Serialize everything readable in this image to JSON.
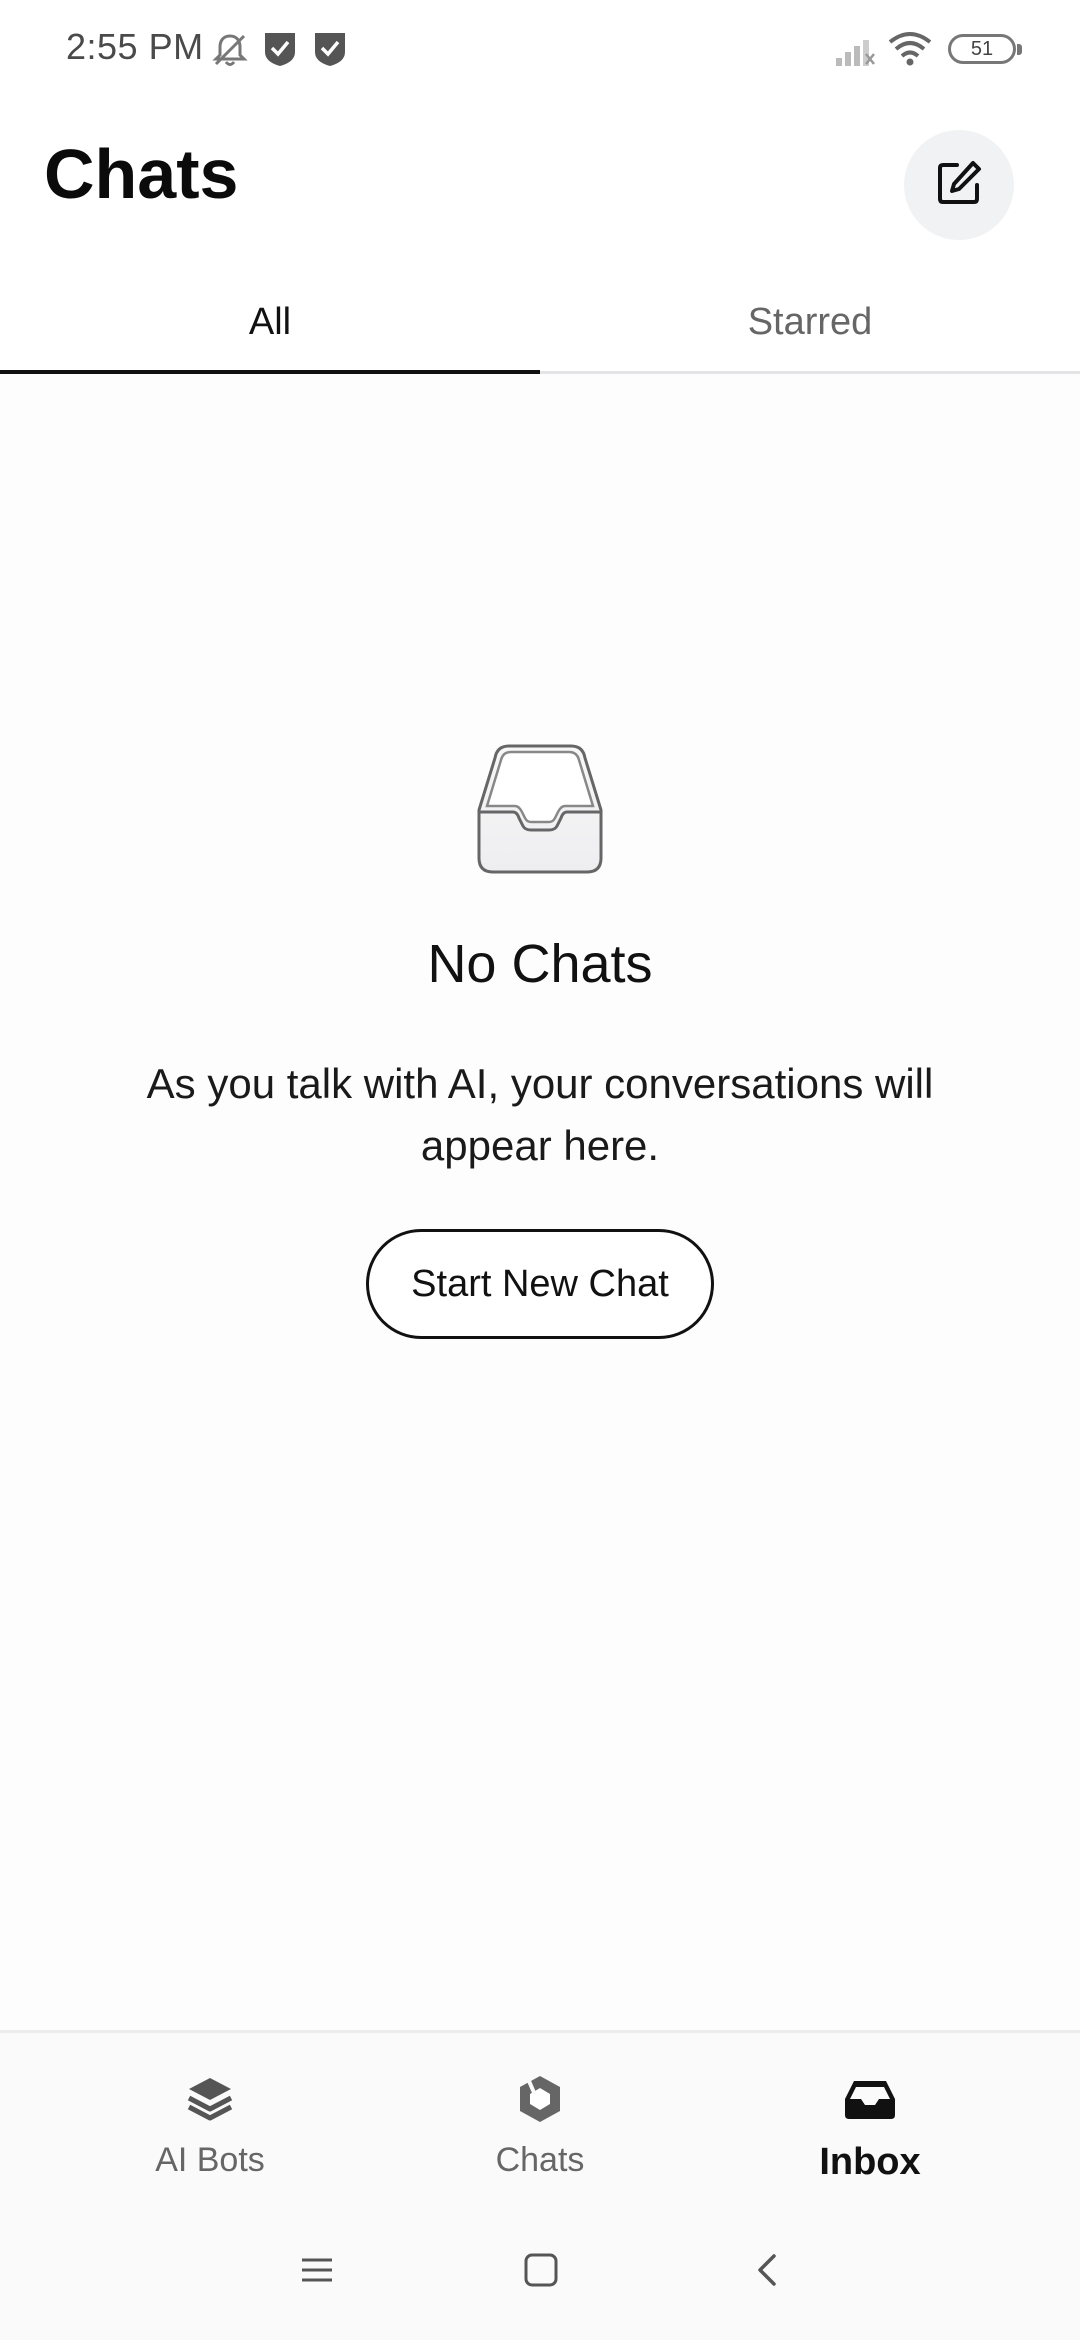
{
  "status_bar": {
    "time": "2:55 PM",
    "battery": "51",
    "icons": [
      "bell-off-icon",
      "shield-icon",
      "shield-icon",
      "signal-icon",
      "wifi-icon",
      "battery-icon"
    ]
  },
  "header": {
    "title": "Chats",
    "compose_icon": "compose-icon"
  },
  "tabs": [
    {
      "label": "All",
      "selected": true
    },
    {
      "label": "Starred",
      "selected": false
    }
  ],
  "empty_state": {
    "icon": "inbox-tray-icon",
    "title": "No Chats",
    "description": "As you talk with AI, your conversations will appear here.",
    "button_label": "Start New Chat"
  },
  "bottom_nav": [
    {
      "label": "AI Bots",
      "icon": "layers-icon",
      "active": false
    },
    {
      "label": "Chats",
      "icon": "hexagon-icon",
      "active": false
    },
    {
      "label": "Inbox",
      "icon": "inbox-icon",
      "active": true
    }
  ],
  "system_nav": [
    "menu-icon",
    "home-icon",
    "back-icon"
  ],
  "colors": {
    "text_primary": "#111111",
    "text_secondary": "#666666",
    "background": "#fdfdfe",
    "compose_bg": "#f1f2f4"
  }
}
